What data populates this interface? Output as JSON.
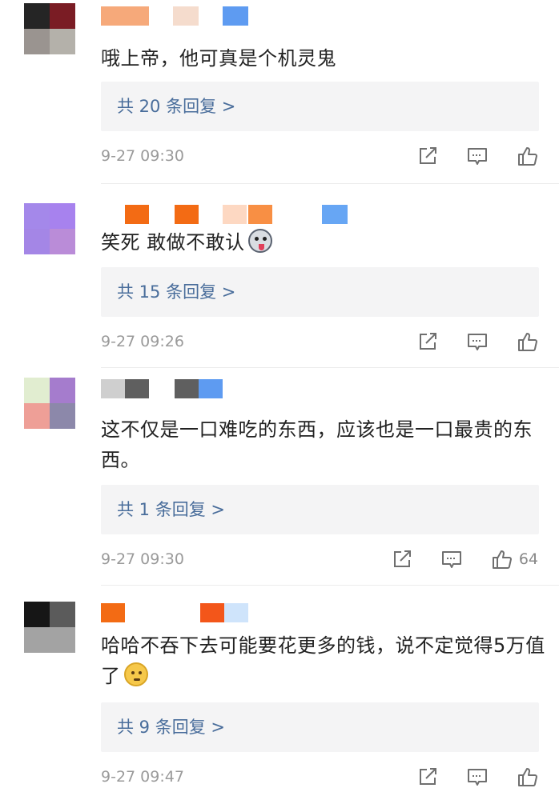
{
  "comments": [
    {
      "text": "哦上帝，他可真是个机灵鬼",
      "replies": "共 20 条回复 >",
      "time": "9-27 09:30",
      "likes": ""
    },
    {
      "text": "笑死 敢做不敢认",
      "replies": "共 15 条回复 >",
      "time": "9-27 09:26",
      "likes": ""
    },
    {
      "text": "这不仅是一口难吃的东西，应该也是一口最贵的东西。",
      "replies": "共 1 条回复 >",
      "time": "9-27 09:30",
      "likes": "64"
    },
    {
      "text": "哈哈不吞下去可能要花更多的钱，说不定觉得5万值了",
      "replies": "共 9 条回复 >",
      "time": "9-27 09:47",
      "likes": ""
    }
  ],
  "colors": {
    "reply_link": "#496d9b",
    "reply_bg": "#f4f4f5",
    "meta_text": "#9a9a9a",
    "icon_stroke": "#6f6f6f"
  },
  "icons": [
    "share-icon",
    "comment-icon",
    "like-icon",
    "dog-emoji-icon",
    "thinking-emoji-icon"
  ]
}
